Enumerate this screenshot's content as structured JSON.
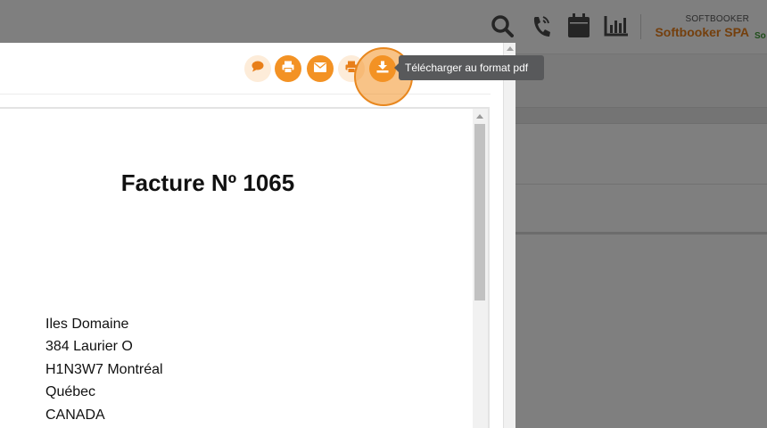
{
  "header": {
    "icons": [
      "search-icon",
      "phone-icon",
      "calendar-icon",
      "chart-icon"
    ],
    "company_caption": "SOFTBOOKER",
    "company_name": "Softbooker SPA",
    "company_sub": "So"
  },
  "toolbar": {
    "buttons": [
      {
        "icon": "comment-icon",
        "style": "light"
      },
      {
        "icon": "print-icon",
        "style": "solid"
      },
      {
        "icon": "envelope-icon",
        "style": "solid"
      },
      {
        "icon": "print-alt-icon",
        "style": "light"
      },
      {
        "icon": "download-icon",
        "style": "solid",
        "state": "hover"
      }
    ],
    "tooltip": "Télécharger au format pdf"
  },
  "document": {
    "title": "Facture Nº 1065",
    "address": [
      "Iles Domaine",
      "384 Laurier O",
      "H1N3W7 Montréal",
      "Québec",
      "CANADA"
    ]
  },
  "colors": {
    "accent": "#f39224",
    "accent_light": "#fdecd9",
    "company_name": "#e87f1a",
    "company_sub": "#3f9c35",
    "tooltip_bg": "#58595b",
    "overlay": "rgba(0,0,0,0.5)"
  }
}
